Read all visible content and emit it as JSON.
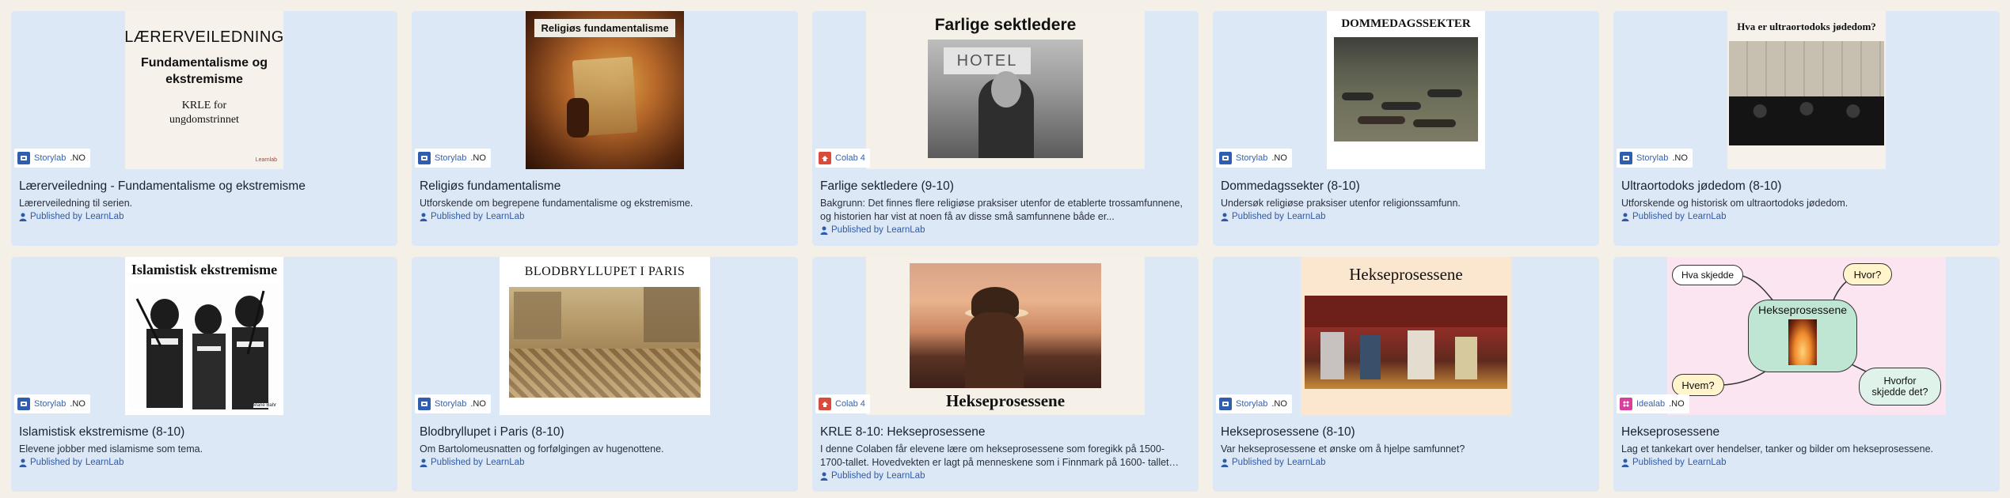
{
  "publisher_prefix": "Published by",
  "cards": [
    {
      "title": "Lærerveiledning - Fundamentalisme og ekstremisme",
      "description": "Lærerveiledning til serien.",
      "publisher": "LearnLab",
      "lab": "Storylab",
      "lang": ".NO",
      "icon": "storylab-icon",
      "thumb": {
        "heading": "LÆRERVEILEDNING",
        "subheading": "Fundamentalisme og ekstremisme",
        "note": "KRLE for ungdomstrinnet",
        "logo": "Learnlab"
      }
    },
    {
      "title": "Religiøs fundamentalisme",
      "description": "Utforskende om begrepene fundamentalisme og ekstremisme.",
      "publisher": "LearnLab",
      "lab": "Storylab",
      "lang": ".NO",
      "icon": "storylab-icon",
      "thumb": {
        "heading": "Religiøs fundamentalisme"
      }
    },
    {
      "title": "Farlige sektledere (9-10)",
      "description": "Bakgrunn: Det finnes flere religiøse praksiser utenfor de etablerte trossamfunnene, og historien har vist at noen få av disse små samfunnene både er...",
      "publisher": "LearnLab",
      "lab": "Colab 4",
      "lang": "",
      "icon": "colab-icon",
      "thumb": {
        "heading": "Farlige sektledere",
        "sign": "HOTEL"
      }
    },
    {
      "title": "Dommedagssekter (8-10)",
      "description": "Undersøk religiøse praksiser utenfor religionssamfunn.",
      "publisher": "LearnLab",
      "lab": "Storylab",
      "lang": ".NO",
      "icon": "storylab-icon",
      "thumb": {
        "heading": "DOMMEDAGSSEKTER"
      }
    },
    {
      "title": "Ultraortodoks jødedom (8-10)",
      "description": "Utforskende og historisk om ultraortodoks jødedom.",
      "publisher": "LearnLab",
      "lab": "Storylab",
      "lang": ".NO",
      "icon": "storylab-icon",
      "thumb": {
        "heading": "Hva er ultraortodoks jødedom?"
      }
    },
    {
      "title": "Islamistisk ekstremisme (8-10)",
      "description": "Elevene jobber med islamisme som tema.",
      "publisher": "LearnLab",
      "lab": "Storylab",
      "lang": ".NO",
      "icon": "storylab-icon",
      "thumb": {
        "heading": "Islamistisk ekstremisme",
        "caption": "Marie Bahr"
      }
    },
    {
      "title": "Blodbryllupet i Paris (8-10)",
      "description": "Om Bartolomeusnatten og forfølgingen av hugenottene.",
      "publisher": "LearnLab",
      "lab": "Storylab",
      "lang": ".NO",
      "icon": "storylab-icon",
      "thumb": {
        "heading": "BLODBRYLLUPET I PARIS"
      }
    },
    {
      "title": "KRLE 8-10: Hekseprosessene",
      "description": "I denne Colaben får elevene lære om hekseprosessene som foregikk på 1500- 1700-tallet. Hovedvekten er lagt på menneskene som i Finnmark på 1600- tallet ble...",
      "publisher": "LearnLab",
      "lab": "Colab 4",
      "lang": "",
      "icon": "colab-icon",
      "thumb": {
        "heading": "Hekseprosessene"
      }
    },
    {
      "title": "Hekseprosessene (8-10)",
      "description": "Var hekseprosessene et ønske om å hjelpe samfunnet?",
      "publisher": "LearnLab",
      "lab": "Storylab",
      "lang": ".NO",
      "icon": "storylab-icon",
      "thumb": {
        "heading": "Hekseprosessene"
      }
    },
    {
      "title": "Hekseprosessene",
      "description": "Lag et tankekart over hendelser, tanker og bilder om hekseprosessene.",
      "publisher": "LearnLab",
      "lab": "Idealab",
      "lang": ".NO",
      "icon": "idealab-icon",
      "thumb": {
        "heading": "Hekseprosessene",
        "bubbles": [
          "Hva skjedde",
          "Hvor?",
          "Hvem?",
          "Hvorfor skjedde det?"
        ]
      }
    }
  ],
  "colors": {
    "card_bg": "#dce8f6",
    "page_bg": "#f4efe7",
    "link": "#2f5aa8",
    "storylab": "#2f5db0",
    "colab": "#d94b3a",
    "idealab": "#d93d9d"
  }
}
